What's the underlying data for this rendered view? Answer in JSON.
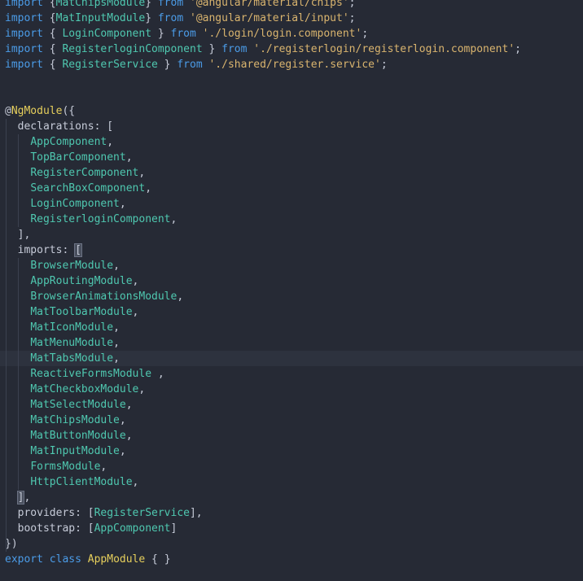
{
  "editor": {
    "language": "typescript",
    "colors": {
      "background": "#262a35",
      "keyword": "#4b9ce8",
      "string": "#d9b46e",
      "class": "#4fc8b0",
      "decorator": "#e6cf5c",
      "text": "#c6cbd8"
    },
    "lines": [
      [
        {
          "t": "import",
          "c": "kw"
        },
        {
          "t": " {",
          "c": "pn"
        },
        {
          "t": "MatChipsModule",
          "c": "cls"
        },
        {
          "t": "} ",
          "c": "pn"
        },
        {
          "t": "from",
          "c": "kw"
        },
        {
          "t": " ",
          "c": "pn"
        },
        {
          "t": "'@angular/material/chips'",
          "c": "str"
        },
        {
          "t": ";",
          "c": "pn"
        }
      ],
      [
        {
          "t": "import",
          "c": "kw"
        },
        {
          "t": " {",
          "c": "pn"
        },
        {
          "t": "MatInputModule",
          "c": "cls"
        },
        {
          "t": "} ",
          "c": "pn"
        },
        {
          "t": "from",
          "c": "kw"
        },
        {
          "t": " ",
          "c": "pn"
        },
        {
          "t": "'@angular/material/input'",
          "c": "str"
        },
        {
          "t": ";",
          "c": "pn"
        }
      ],
      [
        {
          "t": "import",
          "c": "kw"
        },
        {
          "t": " { ",
          "c": "pn"
        },
        {
          "t": "LoginComponent",
          "c": "cls"
        },
        {
          "t": " } ",
          "c": "pn"
        },
        {
          "t": "from",
          "c": "kw"
        },
        {
          "t": " ",
          "c": "pn"
        },
        {
          "t": "'./login/login.component'",
          "c": "str"
        },
        {
          "t": ";",
          "c": "pn"
        }
      ],
      [
        {
          "t": "import",
          "c": "kw"
        },
        {
          "t": " { ",
          "c": "pn"
        },
        {
          "t": "RegisterloginComponent",
          "c": "cls"
        },
        {
          "t": " } ",
          "c": "pn"
        },
        {
          "t": "from",
          "c": "kw"
        },
        {
          "t": " ",
          "c": "pn"
        },
        {
          "t": "'./registerlogin/registerlogin.component'",
          "c": "str"
        },
        {
          "t": ";",
          "c": "pn"
        }
      ],
      [
        {
          "t": "import",
          "c": "kw"
        },
        {
          "t": " { ",
          "c": "pn"
        },
        {
          "t": "RegisterService",
          "c": "cls"
        },
        {
          "t": " } ",
          "c": "pn"
        },
        {
          "t": "from",
          "c": "kw"
        },
        {
          "t": " ",
          "c": "pn"
        },
        {
          "t": "'./shared/register.service'",
          "c": "str"
        },
        {
          "t": ";",
          "c": "pn"
        }
      ],
      [],
      [],
      [
        {
          "t": "@",
          "c": "pn"
        },
        {
          "t": "NgModule",
          "c": "dec"
        },
        {
          "t": "({",
          "c": "pn"
        }
      ],
      [
        {
          "t": "  declarations: [",
          "c": "pn"
        }
      ],
      [
        {
          "t": "    ",
          "c": "pn"
        },
        {
          "t": "AppComponent",
          "c": "cls"
        },
        {
          "t": ",",
          "c": "pn"
        }
      ],
      [
        {
          "t": "    ",
          "c": "pn"
        },
        {
          "t": "TopBarComponent",
          "c": "cls"
        },
        {
          "t": ",",
          "c": "pn"
        }
      ],
      [
        {
          "t": "    ",
          "c": "pn"
        },
        {
          "t": "RegisterComponent",
          "c": "cls"
        },
        {
          "t": ",",
          "c": "pn"
        }
      ],
      [
        {
          "t": "    ",
          "c": "pn"
        },
        {
          "t": "SearchBoxComponent",
          "c": "cls"
        },
        {
          "t": ",",
          "c": "pn"
        }
      ],
      [
        {
          "t": "    ",
          "c": "pn"
        },
        {
          "t": "LoginComponent",
          "c": "cls"
        },
        {
          "t": ",",
          "c": "pn"
        }
      ],
      [
        {
          "t": "    ",
          "c": "pn"
        },
        {
          "t": "RegisterloginComponent",
          "c": "cls"
        },
        {
          "t": ",",
          "c": "pn"
        }
      ],
      [
        {
          "t": "  ],",
          "c": "pn"
        }
      ],
      [
        {
          "t": "  imports: ",
          "c": "pn"
        },
        {
          "t": "[",
          "c": "bm"
        }
      ],
      [
        {
          "t": "    ",
          "c": "pn"
        },
        {
          "t": "BrowserModule",
          "c": "cls"
        },
        {
          "t": ",",
          "c": "pn"
        }
      ],
      [
        {
          "t": "    ",
          "c": "pn"
        },
        {
          "t": "AppRoutingModule",
          "c": "cls"
        },
        {
          "t": ",",
          "c": "pn"
        }
      ],
      [
        {
          "t": "    ",
          "c": "pn"
        },
        {
          "t": "BrowserAnimationsModule",
          "c": "cls"
        },
        {
          "t": ",",
          "c": "pn"
        }
      ],
      [
        {
          "t": "    ",
          "c": "pn"
        },
        {
          "t": "MatToolbarModule",
          "c": "cls"
        },
        {
          "t": ",",
          "c": "pn"
        }
      ],
      [
        {
          "t": "    ",
          "c": "pn"
        },
        {
          "t": "MatIconModule",
          "c": "cls"
        },
        {
          "t": ",",
          "c": "pn"
        }
      ],
      [
        {
          "t": "    ",
          "c": "pn"
        },
        {
          "t": "MatMenuModule",
          "c": "cls"
        },
        {
          "t": ",",
          "c": "pn"
        }
      ],
      [
        {
          "t": "    ",
          "c": "pn"
        },
        {
          "t": "MatTabsModule",
          "c": "cls"
        },
        {
          "t": ",",
          "c": "pn"
        }
      ],
      [
        {
          "t": "    ",
          "c": "pn"
        },
        {
          "t": "ReactiveFormsModule",
          "c": "cls"
        },
        {
          "t": " ,",
          "c": "pn"
        }
      ],
      [
        {
          "t": "    ",
          "c": "pn"
        },
        {
          "t": "MatCheckboxModule",
          "c": "cls"
        },
        {
          "t": ",",
          "c": "pn"
        }
      ],
      [
        {
          "t": "    ",
          "c": "pn"
        },
        {
          "t": "MatSelectModule",
          "c": "cls"
        },
        {
          "t": ",",
          "c": "pn"
        }
      ],
      [
        {
          "t": "    ",
          "c": "pn"
        },
        {
          "t": "MatChipsModule",
          "c": "cls"
        },
        {
          "t": ",",
          "c": "pn"
        }
      ],
      [
        {
          "t": "    ",
          "c": "pn"
        },
        {
          "t": "MatButtonModule",
          "c": "cls"
        },
        {
          "t": ",",
          "c": "pn"
        }
      ],
      [
        {
          "t": "    ",
          "c": "pn"
        },
        {
          "t": "MatInputModule",
          "c": "cls"
        },
        {
          "t": ",",
          "c": "pn"
        }
      ],
      [
        {
          "t": "    ",
          "c": "pn"
        },
        {
          "t": "FormsModule",
          "c": "cls"
        },
        {
          "t": ",",
          "c": "pn"
        }
      ],
      [
        {
          "t": "    ",
          "c": "pn"
        },
        {
          "t": "HttpClientModule",
          "c": "cls"
        },
        {
          "t": ",",
          "c": "pn"
        }
      ],
      [
        {
          "t": "  ",
          "c": "pn"
        },
        {
          "t": "]",
          "c": "bm"
        },
        {
          "t": ",",
          "c": "pn"
        }
      ],
      [
        {
          "t": "  providers: [",
          "c": "pn"
        },
        {
          "t": "RegisterService",
          "c": "cls"
        },
        {
          "t": "],",
          "c": "pn"
        }
      ],
      [
        {
          "t": "  bootstrap: [",
          "c": "pn"
        },
        {
          "t": "AppComponent",
          "c": "cls"
        },
        {
          "t": "]",
          "c": "pn"
        }
      ],
      [
        {
          "t": "})",
          "c": "pn"
        }
      ],
      [
        {
          "t": "export",
          "c": "kw"
        },
        {
          "t": " ",
          "c": "pn"
        },
        {
          "t": "class",
          "c": "kw"
        },
        {
          "t": " ",
          "c": "pn"
        },
        {
          "t": "AppModule",
          "c": "fn"
        },
        {
          "t": " { }",
          "c": "pn"
        }
      ]
    ]
  }
}
